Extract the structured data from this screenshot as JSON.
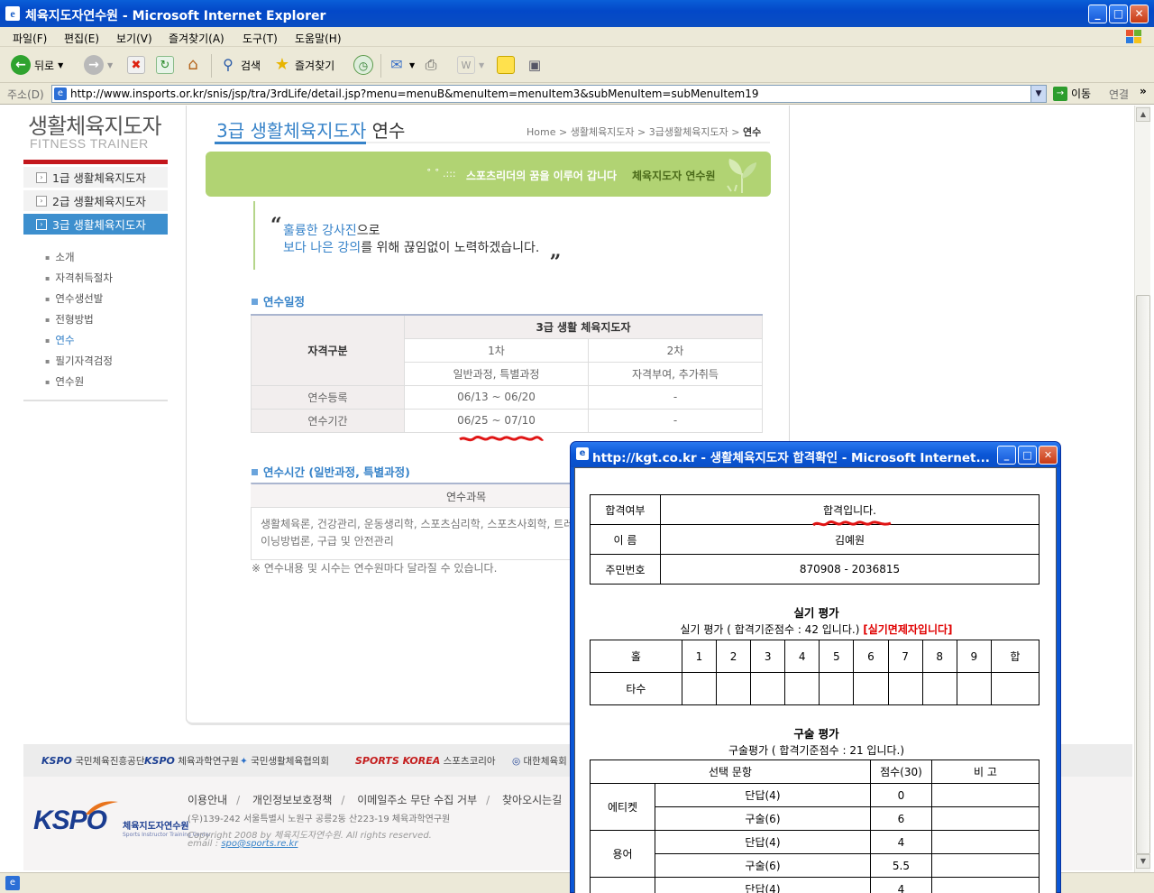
{
  "window": {
    "title": "체육지도자연수원 - Microsoft Internet Explorer",
    "min": "_",
    "max": "□",
    "close": "✕"
  },
  "menubar": [
    "파일(F)",
    "편집(E)",
    "보기(V)",
    "즐겨찾기(A)",
    "도구(T)",
    "도움말(H)"
  ],
  "toolbar": {
    "back": "뒤로",
    "search": "검색",
    "favorites": "즐겨찾기"
  },
  "address": {
    "label": "주소(D)",
    "url": "http://www.insports.or.kr/snis/jsp/tra/3rdLife/detail.jsp?menu=menuB&menuItem=menuItem3&subMenuItem=subMenuItem19",
    "go": "이동",
    "links": "연결"
  },
  "site": {
    "title": "생활체육지도자",
    "subtitle": "FITNESS TRAINER",
    "nav": [
      {
        "label": "1급 생활체육지도자"
      },
      {
        "label": "2급 생활체육지도자"
      },
      {
        "label": "3급 생활체육지도자"
      }
    ],
    "subnav": [
      "소개",
      "자격취득절차",
      "연수생선발",
      "전형방법",
      "연수",
      "필기자격검정",
      "연수원"
    ]
  },
  "page": {
    "heading_blue": "3급 생활체육지도자",
    "heading_dark": " 연수",
    "breadcrumb": [
      "Home",
      "생활체육지도자",
      "3급생활체육지도자",
      "연수"
    ],
    "banner_dots": "˚ ˚ .:::",
    "banner_text": "스포츠리더의 꿈을 이루어 갑니다",
    "banner_em": "체육지도자 연수원",
    "quote_open": "“",
    "quote_close": "„",
    "quote1_blue": "훌륭한 강사진",
    "quote1_rest": "으로",
    "quote2_blue": "보다 나은 강의",
    "quote2_rest": "를 위해 끊임없이 노력하겠습니다.",
    "section1_title": "연수일정",
    "schedule": {
      "corner": "자격구분",
      "group": "3급 생활 체육지도자",
      "col1": "1차",
      "col2": "2차",
      "col1_sub": "일반과정, 특별과정",
      "col2_sub": "자격부여, 추가취득",
      "rows": [
        {
          "label": "연수등록",
          "v1": "06/13 ~ 06/20",
          "v2": "-"
        },
        {
          "label": "연수기간",
          "v1": "06/25 ~ 07/10",
          "v2": "-"
        }
      ]
    },
    "section2_title": "연수시간 (일반과정, 특별과정)",
    "section2_head": "연수과목",
    "section2_body": "생활체육론, 건강관리, 운동생리학, 스포츠심리학, 스포츠사회학, 트레이닝방법론, 구급 및 안전관리",
    "section2_note": "※ 연수내용 및 시수는 연수원마다 달라질 수 있습니다."
  },
  "footer": {
    "logos": [
      {
        "brand": "KSPO",
        "name": "국민체육진흥공단"
      },
      {
        "brand": "KSPO",
        "name": "체육과학연구원"
      },
      {
        "brand": "",
        "name": "국민생활체육협의회"
      },
      {
        "brand": "SPORTS KOREA",
        "name": "스포츠코리아"
      },
      {
        "brand": "",
        "name": "대한체육회"
      }
    ],
    "logo_text": "KSPO",
    "logo_sub": "체육지도자연수원",
    "logo_sub2": "Sports Instructor Training Center",
    "links": [
      "이용안내",
      "개인정보보호정책",
      "이메일주소 무단 수집 거부",
      "찾아오시는길"
    ],
    "address": "(우)139-242 서울특별시 노원구 공릉2동 산223-19 체육과학연구원",
    "copyright": "Copyright 2008 by 체육지도자연수원. All rights reserved.",
    "email_label": "email : ",
    "email": "spo@sports.re.kr"
  },
  "popup": {
    "title": "http://kgt.co.kr - 생활체육지도자 합격확인 - Microsoft Internet...",
    "result": [
      {
        "label": "합격여부",
        "value": "합격입니다."
      },
      {
        "label": "이 름",
        "value": "김예원"
      },
      {
        "label": "주민번호",
        "value": "870908 - 2036815"
      }
    ],
    "practical_title": "실기 평가",
    "practical_sub": "실기 평가 ( 합격기준점수 : 42 입니다.)",
    "practical_exempt": "[실기면제자입니다]",
    "holes_header": [
      "홀",
      "1",
      "2",
      "3",
      "4",
      "5",
      "6",
      "7",
      "8",
      "9",
      "합"
    ],
    "holes_row_label": "타수",
    "oral_title": "구술 평가",
    "oral_sub": "구술평가 ( 합격기준점수 : 21 입니다.)",
    "oral_head": [
      "선택 문항",
      "점수(30)",
      "비 고"
    ],
    "oral_rows": [
      {
        "group": "에티켓",
        "type": "단답(4)",
        "score": "0"
      },
      {
        "group": "",
        "type": "구술(6)",
        "score": "6"
      },
      {
        "group": "용어",
        "type": "단답(4)",
        "score": "4"
      },
      {
        "group": "",
        "type": "구술(6)",
        "score": "5.5"
      },
      {
        "group": "",
        "type": "단답(4)",
        "score": "4"
      }
    ]
  }
}
